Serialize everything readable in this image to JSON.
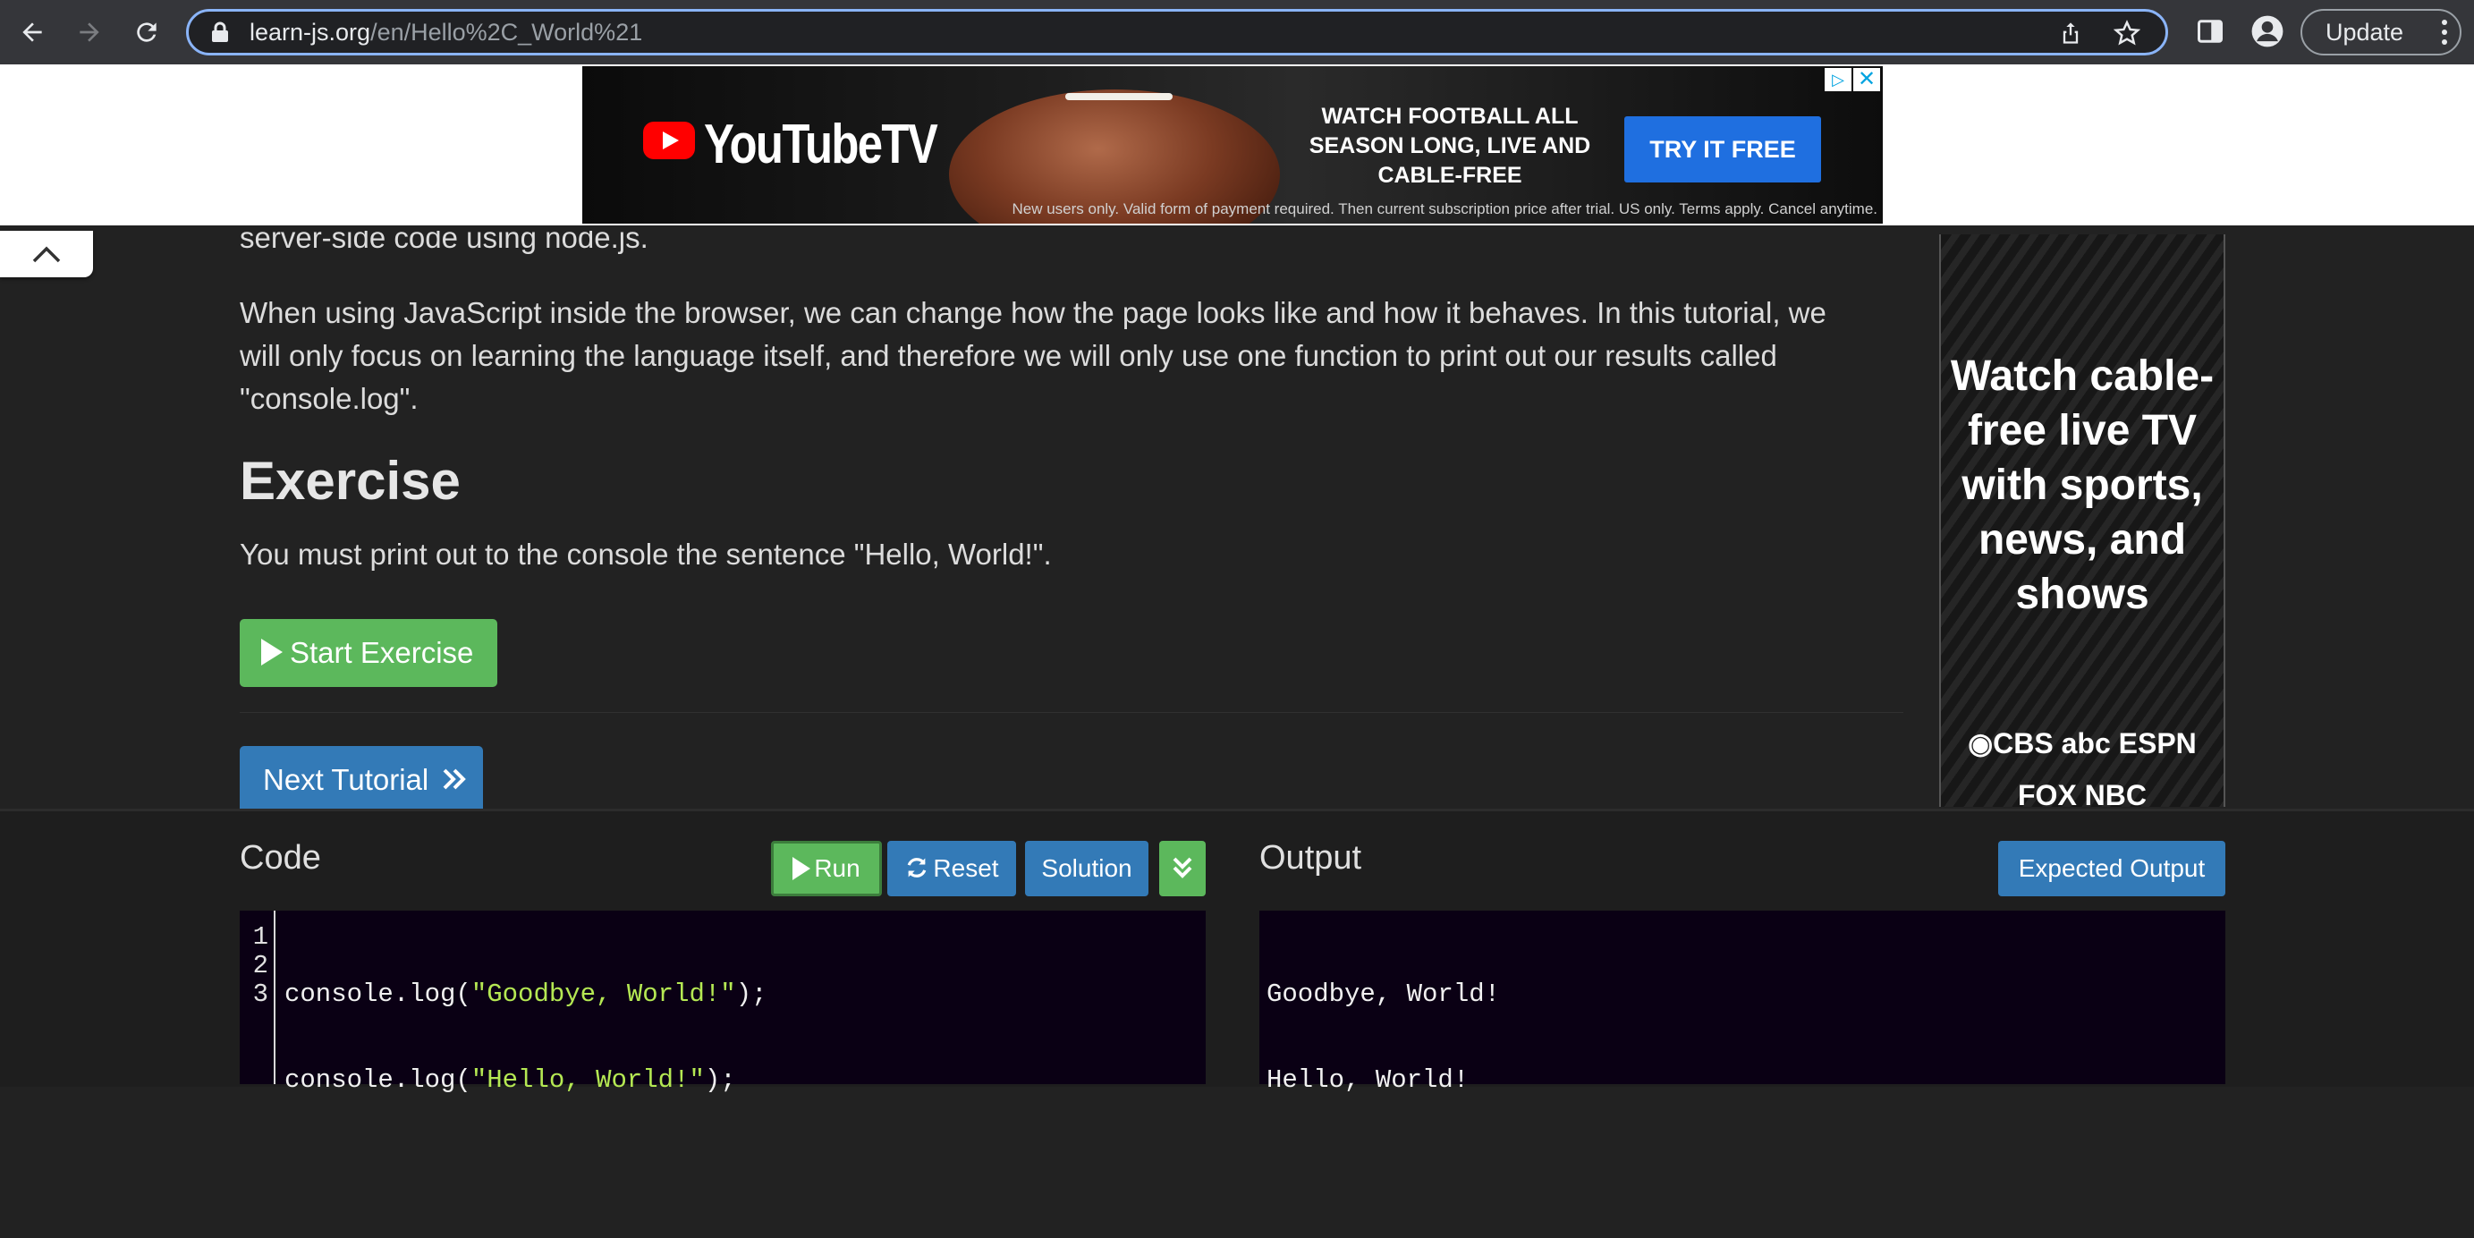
{
  "browser": {
    "url_host": "learn-js.org",
    "url_path": "/en/Hello%2C_World%21",
    "update_label": "Update"
  },
  "top_ad": {
    "brand": "YouTubeTV",
    "headline": "WATCH FOOTBALL ALL SEASON LONG, LIVE AND CABLE-FREE",
    "cta": "TRY IT FREE",
    "fine_print": "New users only. Valid form of payment required. Then current subscription price after trial. US only. Terms apply. Cancel anytime.",
    "adchoices_glyph": "▷",
    "close_glyph": "✕"
  },
  "article": {
    "cut_line": "server-side code using node.js.",
    "paragraph": "When using JavaScript inside the browser, we can change how the page looks like and how it behaves. In this tutorial, we will only focus on learning the language itself, and therefore we will only use one function to print out our results called \"console.log\".",
    "exercise_heading": "Exercise",
    "exercise_text": "You must print out to the console the sentence \"Hello, World!\".",
    "start_exercise_label": "Start Exercise",
    "next_tutorial_label": "Next Tutorial"
  },
  "side_ad": {
    "headline": "Watch cable-free live TV with sports, news, and shows",
    "logos_row1": "◉CBS  abc  ESPN",
    "logos_row2": "FOX  NBC"
  },
  "code_panel": {
    "code_title": "Code",
    "output_title": "Output",
    "run_label": "Run",
    "reset_label": "Reset",
    "solution_label": "Solution",
    "expected_output_label": "Expected Output",
    "line_numbers": [
      "1",
      "2",
      "3"
    ],
    "code": [
      {
        "prefix": "console.log(",
        "string": "\"Goodbye, World!\"",
        "suffix": ");"
      },
      {
        "prefix": "console.log(",
        "string": "\"Hello, World!\"",
        "suffix": ");"
      },
      {
        "prefix": "",
        "string": "",
        "suffix": ""
      }
    ],
    "output_lines": [
      "Goodbye, World!",
      "Hello, World!"
    ]
  },
  "colors": {
    "page_bg": "#222222",
    "btn_green": "#5cb85c",
    "btn_blue": "#337ab7",
    "code_string": "#b5e853",
    "editor_bg": "#0a0014"
  }
}
